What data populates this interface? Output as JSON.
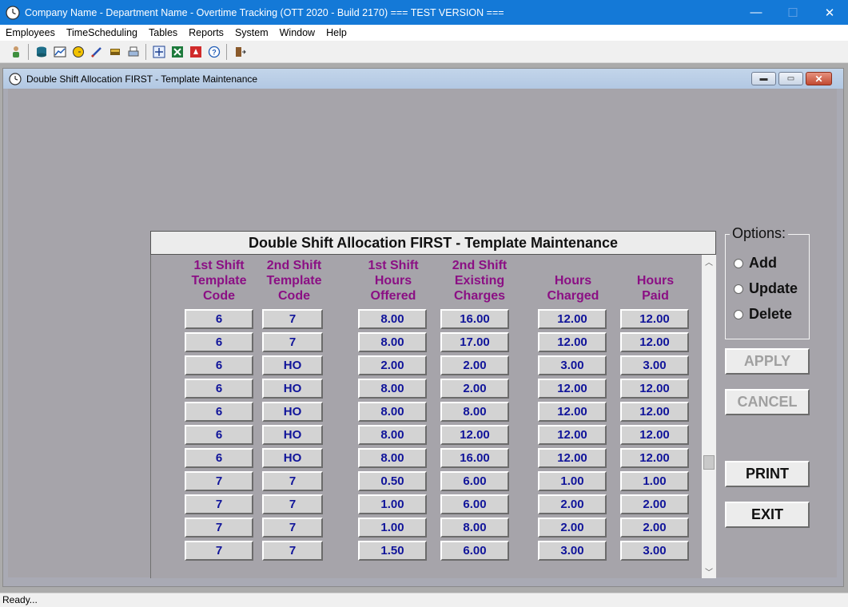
{
  "window": {
    "title": "Company Name - Department Name - Overtime Tracking (OTT 2020 - Build 2170)  === TEST VERSION ===",
    "minimize": "—",
    "maximize": "☐",
    "close": "✕"
  },
  "menu": [
    "Employees",
    "TimeScheduling",
    "Tables",
    "Reports",
    "System",
    "Window",
    "Help"
  ],
  "toolbar_icons": [
    "employee-icon",
    "database-icon",
    "chart-icon",
    "clock-icon",
    "pen-icon",
    "book-icon",
    "printer-icon",
    "network-icon",
    "excel-icon",
    "hand-icon",
    "help-icon",
    "exit-door-icon"
  ],
  "child": {
    "title": "Double Shift Allocation FIRST - Template Maintenance",
    "min": "▬",
    "restore": "▭",
    "close": "✕"
  },
  "panel": {
    "header": "Double Shift Allocation FIRST - Template Maintenance"
  },
  "columns": [
    "1st Shift\nTemplate\nCode",
    "2nd Shift\nTemplate\nCode",
    "1st Shift\nHours\nOffered",
    "2nd Shift\nExisting\nCharges",
    "Hours\nCharged",
    "Hours\nPaid"
  ],
  "rows": [
    [
      "6",
      "7",
      "8.00",
      "16.00",
      "12.00",
      "12.00"
    ],
    [
      "6",
      "7",
      "8.00",
      "17.00",
      "12.00",
      "12.00"
    ],
    [
      "6",
      "HO",
      "2.00",
      "2.00",
      "3.00",
      "3.00"
    ],
    [
      "6",
      "HO",
      "8.00",
      "2.00",
      "12.00",
      "12.00"
    ],
    [
      "6",
      "HO",
      "8.00",
      "8.00",
      "12.00",
      "12.00"
    ],
    [
      "6",
      "HO",
      "8.00",
      "12.00",
      "12.00",
      "12.00"
    ],
    [
      "6",
      "HO",
      "8.00",
      "16.00",
      "12.00",
      "12.00"
    ],
    [
      "7",
      "7",
      "0.50",
      "6.00",
      "1.00",
      "1.00"
    ],
    [
      "7",
      "7",
      "1.00",
      "6.00",
      "2.00",
      "2.00"
    ],
    [
      "7",
      "7",
      "1.00",
      "8.00",
      "2.00",
      "2.00"
    ],
    [
      "7",
      "7",
      "1.50",
      "6.00",
      "3.00",
      "3.00"
    ]
  ],
  "options": {
    "legend": "Options:",
    "add": "Add",
    "update": "Update",
    "delete": "Delete"
  },
  "buttons": {
    "apply": "APPLY",
    "cancel": "CANCEL",
    "print": "PRINT",
    "exit": "EXIT"
  },
  "status": "Ready...",
  "colors": {
    "title_bar": "#1479d7",
    "header_text": "#8b0f84",
    "cell_text": "#10149a",
    "form_bg": "#a6a4aa"
  }
}
